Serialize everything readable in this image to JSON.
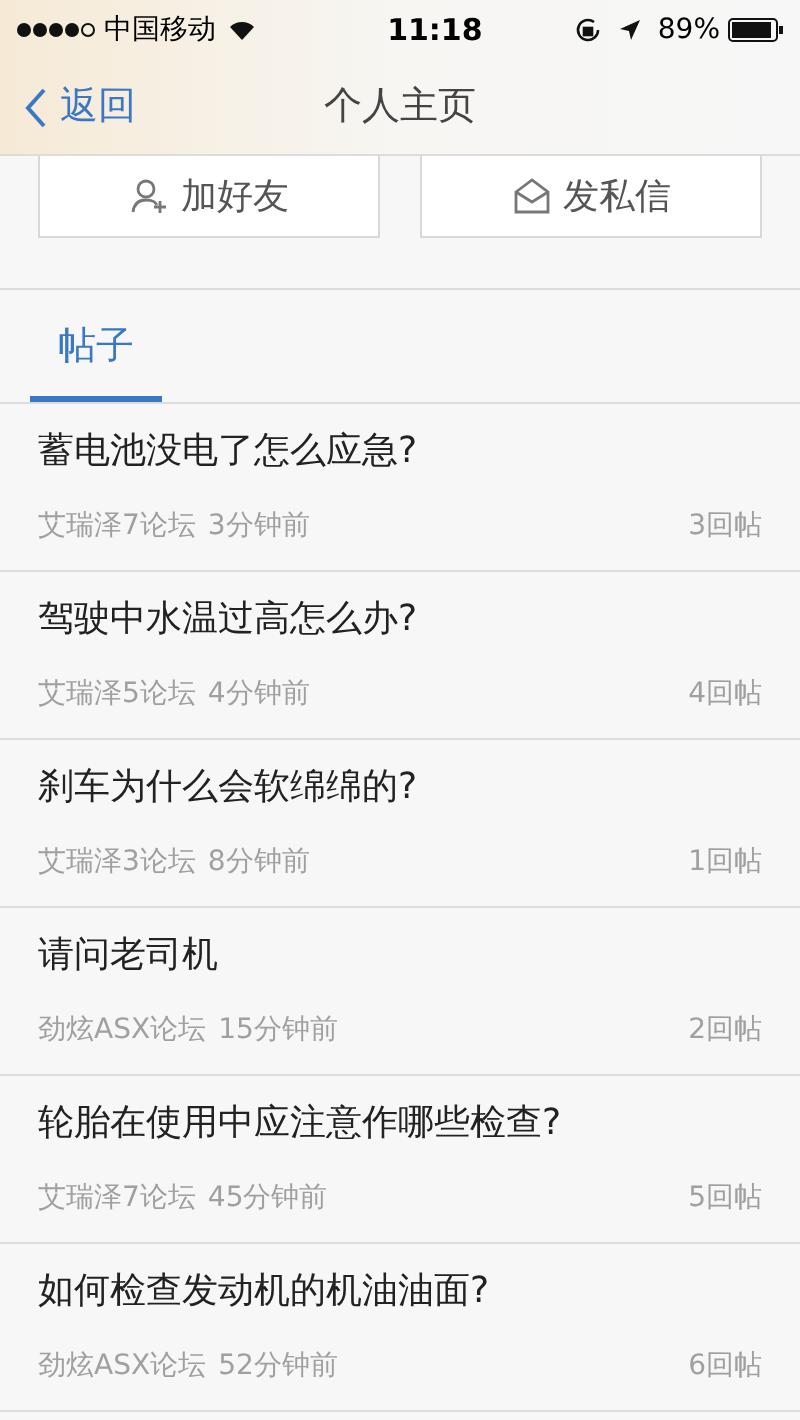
{
  "status_bar": {
    "carrier": "中国移动",
    "time": "11:18",
    "battery": "89%"
  },
  "nav": {
    "back": "返回",
    "title": "个人主页"
  },
  "actions": [
    {
      "kind": "add-friend",
      "label": "加好友"
    },
    {
      "kind": "message",
      "label": "发私信"
    }
  ],
  "tabs": [
    {
      "label": "帖子",
      "selected": true
    }
  ],
  "posts": [
    {
      "title": "蓄电池没电了怎么应急?",
      "forum": "艾瑞泽7论坛",
      "time": "3分钟前",
      "replies": "3回帖"
    },
    {
      "title": "驾驶中水温过高怎么办?",
      "forum": "艾瑞泽5论坛",
      "time": "4分钟前",
      "replies": "4回帖"
    },
    {
      "title": "刹车为什么会软绵绵的?",
      "forum": "艾瑞泽3论坛",
      "time": "8分钟前",
      "replies": "1回帖"
    },
    {
      "title": "请问老司机",
      "forum": "劲炫ASX论坛",
      "time": "15分钟前",
      "replies": "2回帖"
    },
    {
      "title": "轮胎在使用中应注意作哪些检查?",
      "forum": "艾瑞泽7论坛",
      "time": "45分钟前",
      "replies": "5回帖"
    },
    {
      "title": "如何检查发动机的机油油面?",
      "forum": "劲炫ASX论坛",
      "time": "52分钟前",
      "replies": "6回帖"
    }
  ]
}
